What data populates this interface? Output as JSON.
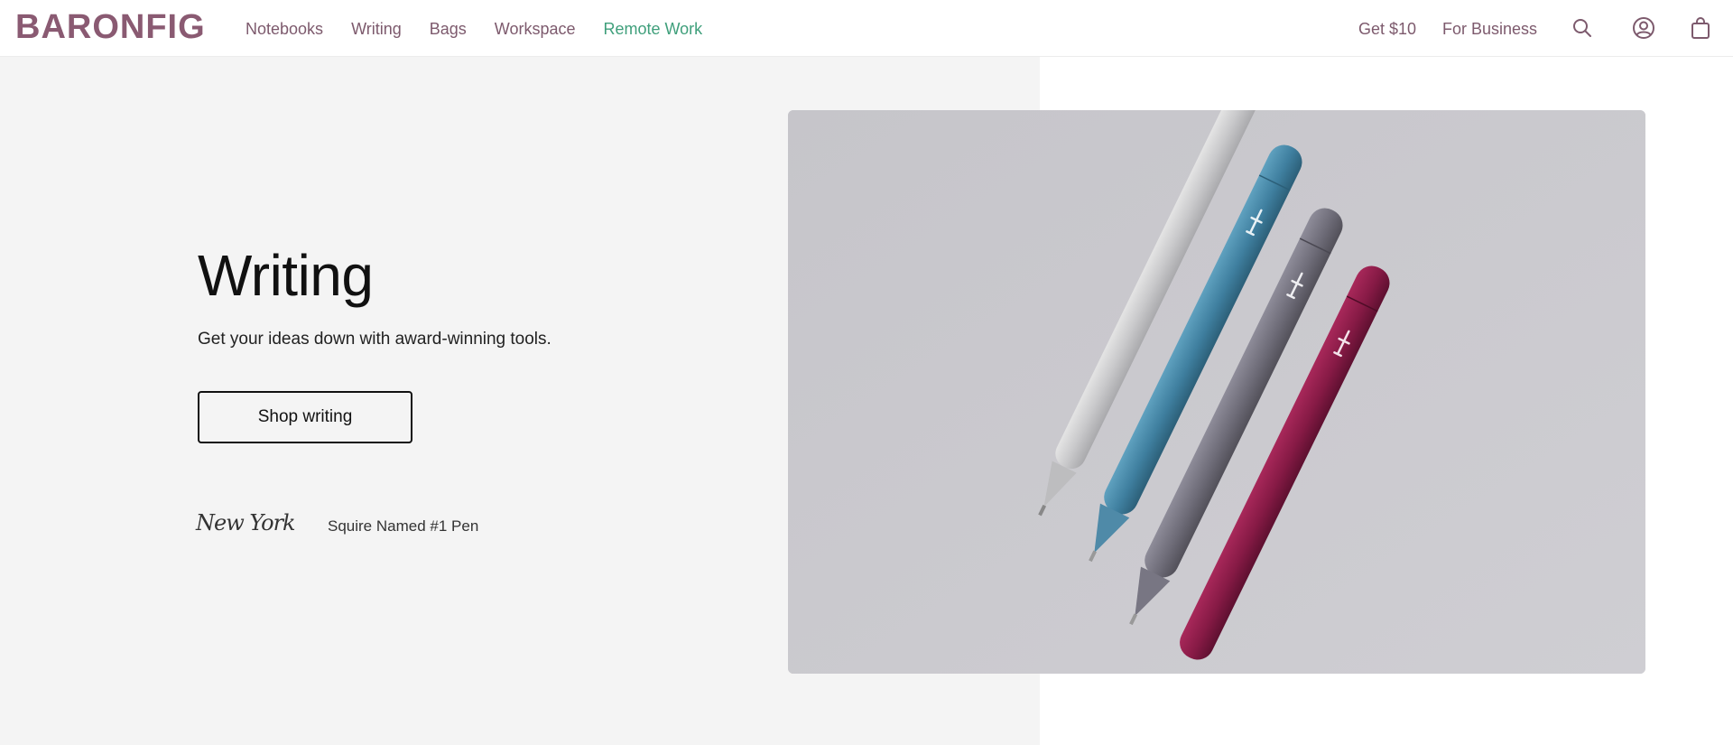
{
  "header": {
    "logo": "BARONFIG",
    "nav": [
      {
        "label": "Notebooks"
      },
      {
        "label": "Writing"
      },
      {
        "label": "Bags"
      },
      {
        "label": "Workspace"
      },
      {
        "label": "Remote Work"
      }
    ],
    "get_offer": "Get $10",
    "for_business": "For Business",
    "icons": [
      "search-icon",
      "account-icon",
      "bag-icon"
    ]
  },
  "hero": {
    "title": "Writing",
    "subtitle": "Get your ideas down with award-winning tools.",
    "cta_label": "Shop writing",
    "press_logo": "New York",
    "press_quote": "Squire Named #1 Pen",
    "image_alt": "Four Squire pens in silver, blue, gray and burgundy"
  },
  "colors": {
    "brand": "#8a5a72",
    "accent": "#3f9f7b",
    "hero_bg": "#f4f4f4"
  }
}
